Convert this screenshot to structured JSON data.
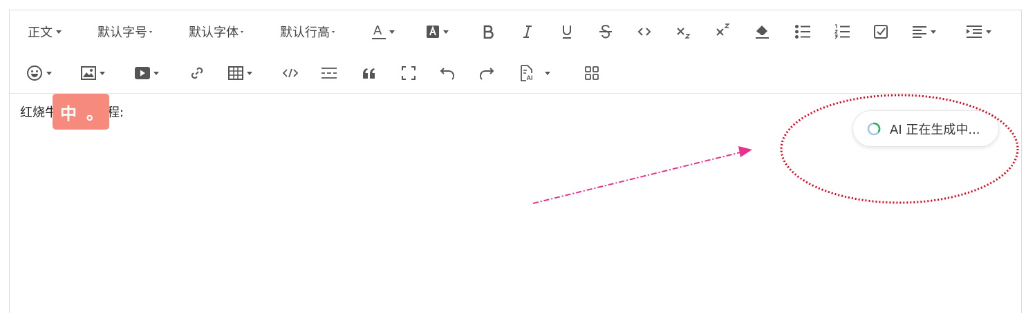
{
  "toolbar": {
    "paragraph_label": "正文",
    "font_size_label": "默认字号",
    "font_family_label": "默认字体",
    "line_height_label": "默认行高",
    "font_color_letter": "A",
    "icons": {
      "row1": [
        "font-color-icon",
        "background-color-icon",
        "bold-icon",
        "italic-icon",
        "underline-icon",
        "strikethrough-icon",
        "inline-code-icon",
        "subscript-icon",
        "superscript-icon",
        "eraser-icon",
        "bullet-list-icon",
        "ordered-list-icon",
        "todo-icon",
        "align-left-icon",
        "indent-icon"
      ],
      "row2": [
        "emoji-icon",
        "image-icon",
        "video-icon",
        "link-icon",
        "table-icon",
        "code-block-icon",
        "divider-icon",
        "quote-icon",
        "fullscreen-icon",
        "undo-icon",
        "redo-icon",
        "ai-document-icon",
        "more-grid-icon"
      ]
    }
  },
  "content": {
    "text": "红烧牛肉制作过程:"
  },
  "ime": {
    "char": "中",
    "punct": "。"
  },
  "ai_status": {
    "text": "AI 正在生成中..."
  },
  "colors": {
    "ime_bg": "#f68a7c",
    "annotation_ellipse": "#e0001a",
    "annotation_arrow": "#e8308c",
    "spinner_accent": "#2faa5e",
    "spinner_track": "#9ac8e8"
  }
}
